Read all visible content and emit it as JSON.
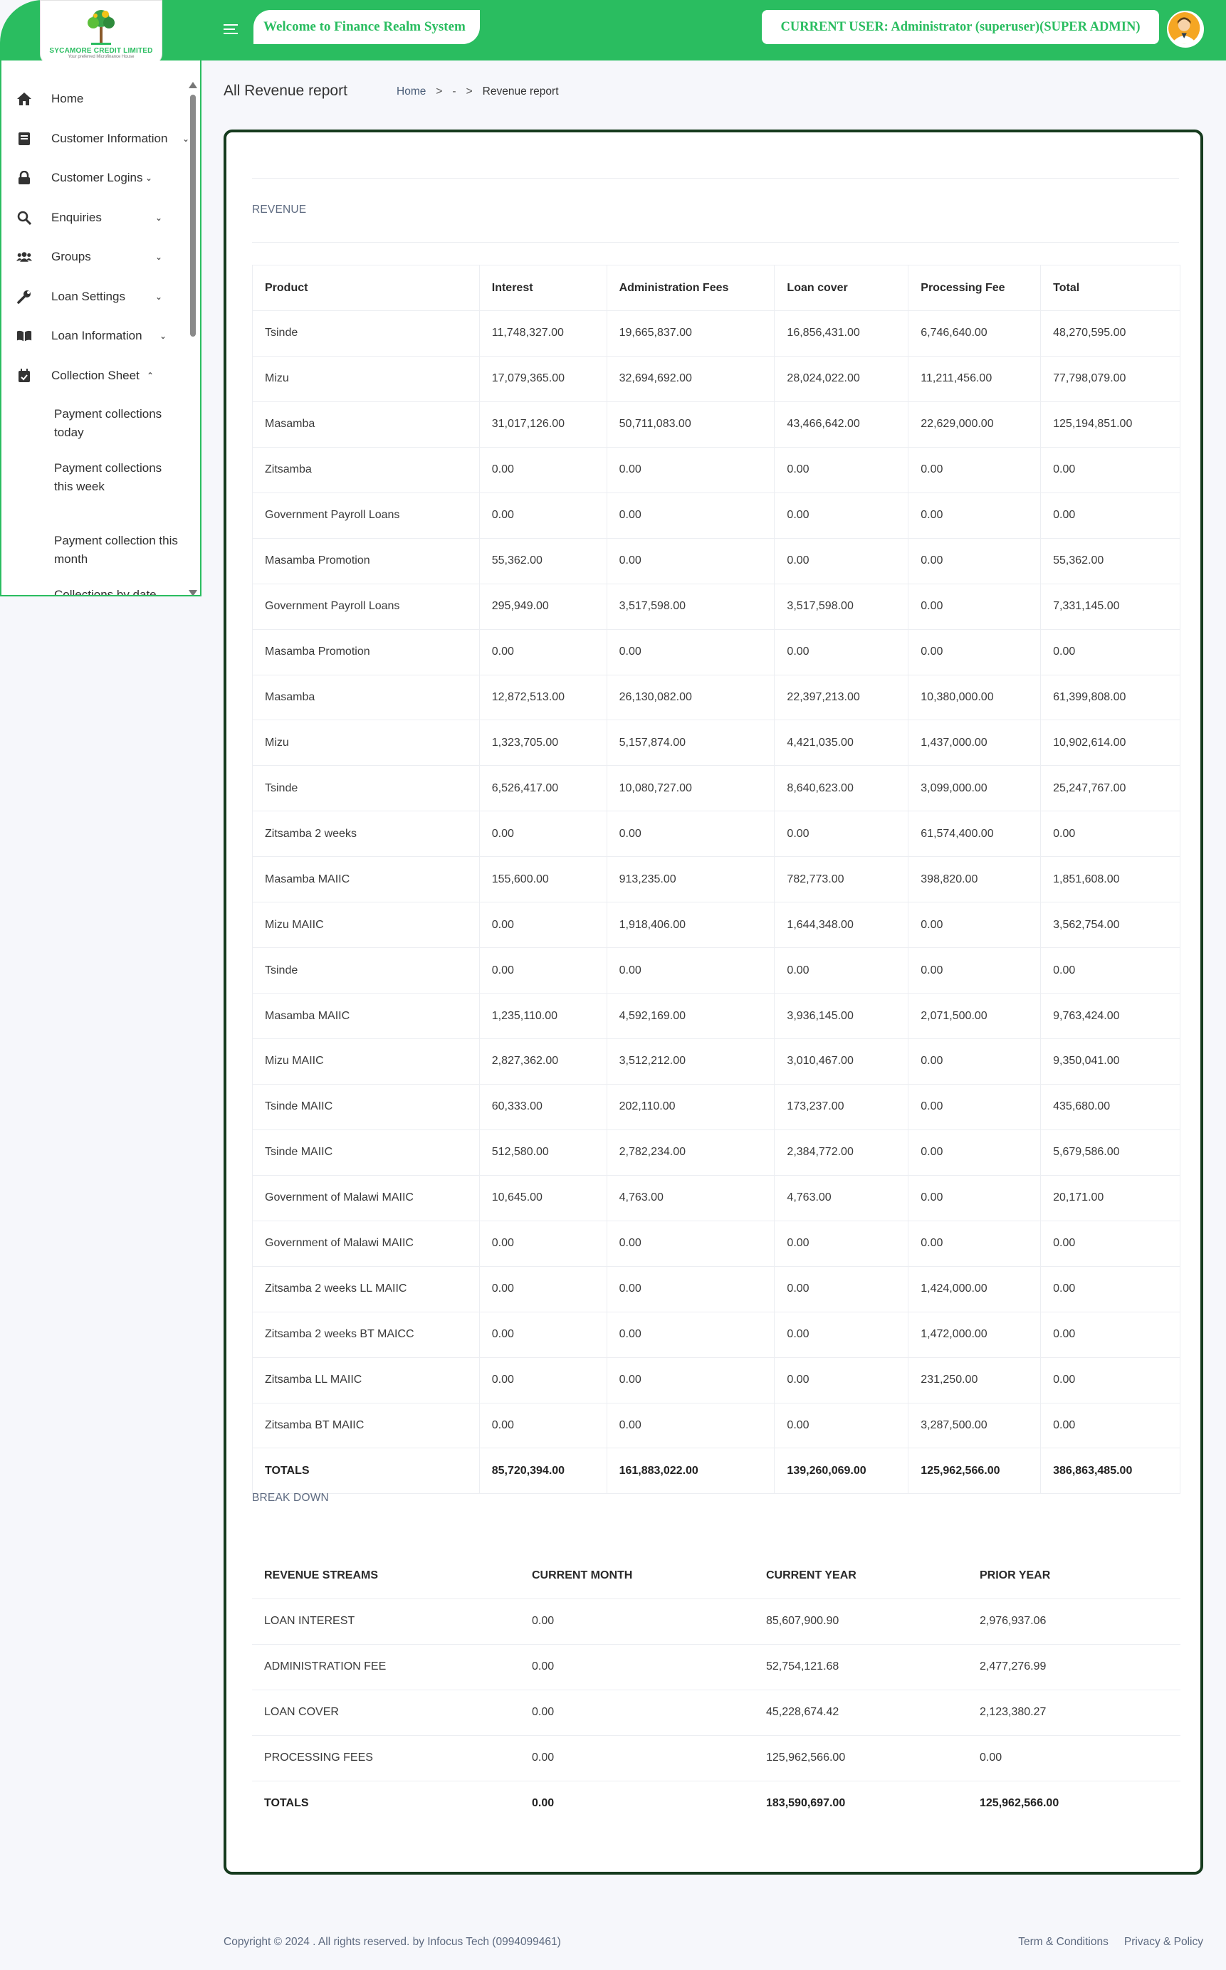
{
  "header": {
    "logo_text": "SYCAMORE CREDIT LIMITED",
    "logo_tagline": "Your preferred Microfinance House",
    "welcome": "Welcome to Finance Realm System",
    "current_user": "CURRENT USER: Administrator (superuser)(SUPER ADMIN)",
    "brand_color": "#2abd60"
  },
  "sidebar": {
    "items": [
      {
        "label": "Home",
        "icon": "home-icon",
        "chevron": ""
      },
      {
        "label": "Customer Information",
        "icon": "book-icon",
        "chevron": "⌄"
      },
      {
        "label": "Customer Logins",
        "icon": "lock-icon",
        "chevron": "⌄"
      },
      {
        "label": "Enquiries",
        "icon": "search-icon",
        "chevron": "⌄"
      },
      {
        "label": "Groups",
        "icon": "users-icon",
        "chevron": "⌄"
      },
      {
        "label": "Loan Settings",
        "icon": "wrench-icon",
        "chevron": "⌄"
      },
      {
        "label": "Loan Information",
        "icon": "open-book-icon",
        "chevron": "⌄"
      },
      {
        "label": "Collection Sheet",
        "icon": "calendar-check-icon",
        "chevron": "⌃"
      }
    ],
    "sub_items": [
      "Payment collections today",
      "Payment collections this week",
      "Payment collection this month",
      "Collections by date"
    ]
  },
  "page": {
    "title": "All Revenue report",
    "breadcrumb": [
      "Home",
      ">",
      "-",
      ">",
      "Revenue report"
    ]
  },
  "revenue": {
    "section_label": "REVENUE",
    "columns": [
      "Product",
      "Interest",
      "Administration Fees",
      "Loan cover",
      "Processing Fee",
      "Total"
    ],
    "rows": [
      [
        "Tsinde",
        "11,748,327.00",
        "19,665,837.00",
        "16,856,431.00",
        "6,746,640.00",
        "48,270,595.00"
      ],
      [
        "Mizu",
        "17,079,365.00",
        "32,694,692.00",
        "28,024,022.00",
        "11,211,456.00",
        "77,798,079.00"
      ],
      [
        "Masamba",
        "31,017,126.00",
        "50,711,083.00",
        "43,466,642.00",
        "22,629,000.00",
        "125,194,851.00"
      ],
      [
        "Zitsamba",
        "0.00",
        "0.00",
        "0.00",
        "0.00",
        "0.00"
      ],
      [
        "Government Payroll Loans",
        "0.00",
        "0.00",
        "0.00",
        "0.00",
        "0.00"
      ],
      [
        "Masamba Promotion",
        "55,362.00",
        "0.00",
        "0.00",
        "0.00",
        "55,362.00"
      ],
      [
        "Government Payroll Loans",
        "295,949.00",
        "3,517,598.00",
        "3,517,598.00",
        "0.00",
        "7,331,145.00"
      ],
      [
        "Masamba Promotion",
        "0.00",
        "0.00",
        "0.00",
        "0.00",
        "0.00"
      ],
      [
        "Masamba",
        "12,872,513.00",
        "26,130,082.00",
        "22,397,213.00",
        "10,380,000.00",
        "61,399,808.00"
      ],
      [
        "Mizu",
        "1,323,705.00",
        "5,157,874.00",
        "4,421,035.00",
        "1,437,000.00",
        "10,902,614.00"
      ],
      [
        "Tsinde",
        "6,526,417.00",
        "10,080,727.00",
        "8,640,623.00",
        "3,099,000.00",
        "25,247,767.00"
      ],
      [
        "Zitsamba 2 weeks",
        "0.00",
        "0.00",
        "0.00",
        "61,574,400.00",
        "0.00"
      ],
      [
        "Masamba MAIIC",
        "155,600.00",
        "913,235.00",
        "782,773.00",
        "398,820.00",
        "1,851,608.00"
      ],
      [
        "Mizu MAIIC",
        "0.00",
        "1,918,406.00",
        "1,644,348.00",
        "0.00",
        "3,562,754.00"
      ],
      [
        "Tsinde",
        "0.00",
        "0.00",
        "0.00",
        "0.00",
        "0.00"
      ],
      [
        "Masamba MAIIC",
        "1,235,110.00",
        "4,592,169.00",
        "3,936,145.00",
        "2,071,500.00",
        "9,763,424.00"
      ],
      [
        "Mizu MAIIC",
        "2,827,362.00",
        "3,512,212.00",
        "3,010,467.00",
        "0.00",
        "9,350,041.00"
      ],
      [
        "Tsinde MAIIC",
        "60,333.00",
        "202,110.00",
        "173,237.00",
        "0.00",
        "435,680.00"
      ],
      [
        "Tsinde MAIIC",
        "512,580.00",
        "2,782,234.00",
        "2,384,772.00",
        "0.00",
        "5,679,586.00"
      ],
      [
        "Government of Malawi MAIIC",
        "10,645.00",
        "4,763.00",
        "4,763.00",
        "0.00",
        "20,171.00"
      ],
      [
        "Government of Malawi MAIIC",
        "0.00",
        "0.00",
        "0.00",
        "0.00",
        "0.00"
      ],
      [
        "Zitsamba 2 weeks LL MAIIC",
        "0.00",
        "0.00",
        "0.00",
        "1,424,000.00",
        "0.00"
      ],
      [
        "Zitsamba 2 weeks BT MAICC",
        "0.00",
        "0.00",
        "0.00",
        "1,472,000.00",
        "0.00"
      ],
      [
        "Zitsamba LL MAIIC",
        "0.00",
        "0.00",
        "0.00",
        "231,250.00",
        "0.00"
      ],
      [
        "Zitsamba BT MAIIC",
        "0.00",
        "0.00",
        "0.00",
        "3,287,500.00",
        "0.00"
      ]
    ],
    "totals": [
      "TOTALS",
      "85,720,394.00",
      "161,883,022.00",
      "139,260,069.00",
      "125,962,566.00",
      "386,863,485.00"
    ]
  },
  "breakdown": {
    "section_label": "BREAK DOWN",
    "columns": [
      "REVENUE STREAMS",
      "CURRENT MONTH",
      "CURRENT YEAR",
      "PRIOR YEAR"
    ],
    "rows": [
      [
        "LOAN INTEREST",
        "0.00",
        "85,607,900.90",
        "2,976,937.06"
      ],
      [
        "ADMINISTRATION FEE",
        "0.00",
        "52,754,121.68",
        "2,477,276.99"
      ],
      [
        "LOAN COVER",
        "0.00",
        "45,228,674.42",
        "2,123,380.27"
      ],
      [
        "PROCESSING FEES",
        "0.00",
        "125,962,566.00",
        "0.00"
      ]
    ],
    "totals": [
      "TOTALS",
      "0.00",
      "183,590,697.00",
      "125,962,566.00"
    ]
  },
  "footer": {
    "copyright": "Copyright © 2024 . All rights reserved. by Infocus Tech (0994099461)",
    "links": [
      "Term & Conditions",
      "Privacy & Policy"
    ]
  }
}
